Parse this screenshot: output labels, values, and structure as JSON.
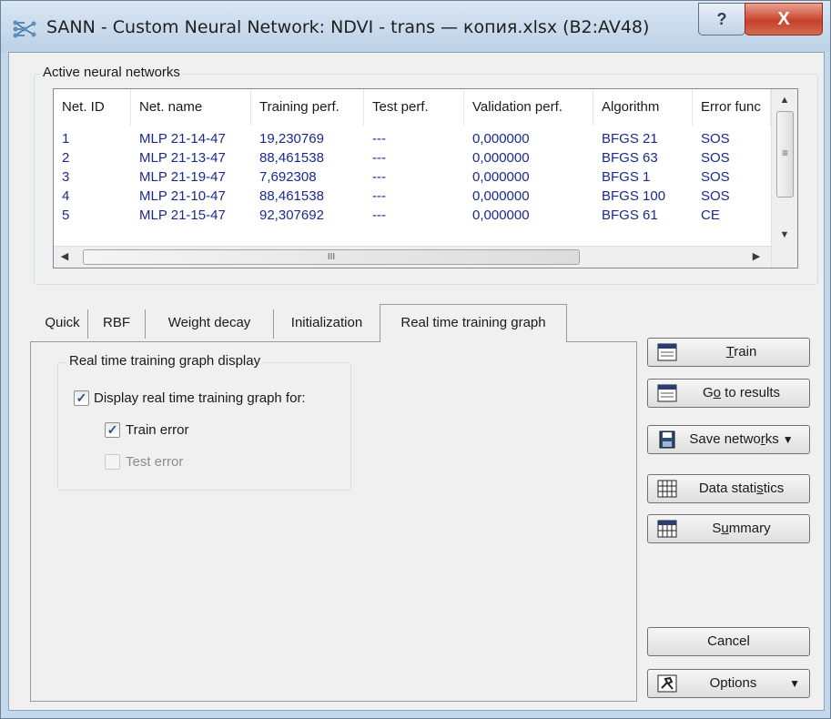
{
  "window": {
    "title": "SANN - Custom Neural Network: NDVI - trans — копия.xlsx (B2:AV48)",
    "help_label": "?",
    "close_label": "X"
  },
  "networks": {
    "group_label": "Active neural networks",
    "columns": [
      "Net. ID",
      "Net. name",
      "Training perf.",
      "Test perf.",
      "Validation perf.",
      "Algorithm",
      "Error func"
    ],
    "rows": [
      [
        "1",
        "MLP 21-14-47",
        "19,230769",
        "---",
        "0,000000",
        "BFGS 21",
        "SOS"
      ],
      [
        "2",
        "MLP 21-13-47",
        "88,461538",
        "---",
        "0,000000",
        "BFGS 63",
        "SOS"
      ],
      [
        "3",
        "MLP 21-19-47",
        "7,692308",
        "---",
        "0,000000",
        "BFGS 1",
        "SOS"
      ],
      [
        "4",
        "MLP 21-10-47",
        "88,461538",
        "---",
        "0,000000",
        "BFGS 100",
        "SOS"
      ],
      [
        "5",
        "MLP 21-15-47",
        "92,307692",
        "---",
        "0,000000",
        "BFGS 61",
        "CE"
      ]
    ],
    "scroll_thumb_label": "III",
    "vscroll_grip": "≡"
  },
  "tabs": {
    "items": [
      "Quick",
      "RBF",
      "Weight decay",
      "Initialization"
    ],
    "active": "Real time training graph"
  },
  "graph_panel": {
    "group_label": "Real time training graph display",
    "display_graph": {
      "label": "Display real time training graph for:",
      "checked": true
    },
    "train_error": {
      "label": "Train error",
      "checked": true
    },
    "test_error": {
      "label": "Test error",
      "checked": false,
      "enabled": false
    }
  },
  "buttons": {
    "train": {
      "prefix": "",
      "mnemonic": "T",
      "suffix": "rain"
    },
    "goto": {
      "prefix": "G",
      "mnemonic": "o",
      "suffix": " to results"
    },
    "save": {
      "prefix": "Save netwo",
      "mnemonic": "r",
      "suffix": "ks"
    },
    "stats": {
      "prefix": "Data stati",
      "mnemonic": "s",
      "suffix": "tics"
    },
    "summary": {
      "prefix": "S",
      "mnemonic": "u",
      "suffix": "mmary"
    },
    "cancel": {
      "label": "Cancel"
    },
    "options": {
      "label": "Options"
    }
  },
  "colors": {
    "accent": "#1a2a8c",
    "close": "#c9412a"
  }
}
